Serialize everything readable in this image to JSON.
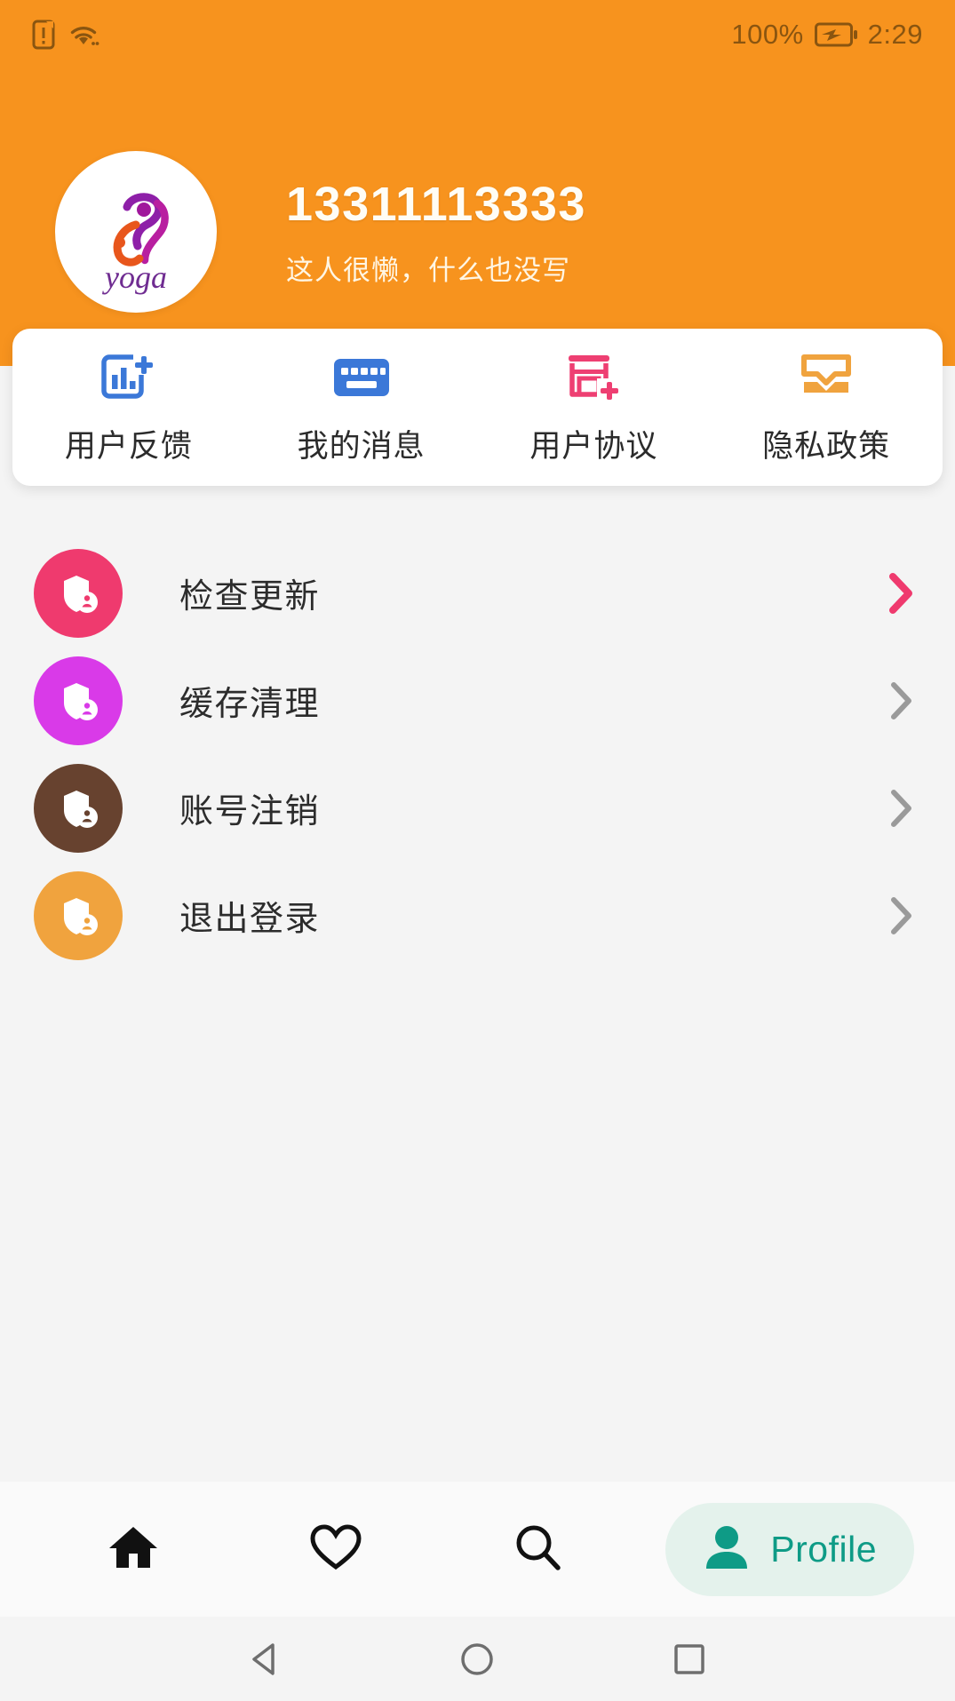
{
  "status_bar": {
    "sim_icon": "sim-alert-icon",
    "wifi_icon": "wifi-icon",
    "battery_percent": "100%",
    "battery_icon": "battery-charging-icon",
    "time": "2:29"
  },
  "header": {
    "background_color": "#f7931e",
    "avatar_icon": "yoga-logo-avatar",
    "avatar_logo_text": "yoga",
    "username": "13311113333",
    "signature": "这人很懒，什么也没写"
  },
  "quick_actions": [
    {
      "label": "用户反馈",
      "icon": "chart-add-icon",
      "color": "#3b78d8"
    },
    {
      "label": "我的消息",
      "icon": "keyboard-icon",
      "color": "#3b78d8"
    },
    {
      "label": "用户协议",
      "icon": "shop-add-icon",
      "color": "#ee3f72"
    },
    {
      "label": "隐私政策",
      "icon": "inbox-tray-icon",
      "color": "#f0a33e"
    }
  ],
  "menu": [
    {
      "label": "检查更新",
      "icon": "shield-user-icon",
      "badge_color": "#ef3a6e",
      "chevron_color": "#ef3a6e"
    },
    {
      "label": "缓存清理",
      "icon": "shield-user-icon",
      "badge_color": "#d93ae8",
      "chevron_color": "#9a9a9a"
    },
    {
      "label": "账号注销",
      "icon": "shield-user-icon",
      "badge_color": "#67422f",
      "chevron_color": "#9a9a9a"
    },
    {
      "label": "退出登录",
      "icon": "shield-user-icon",
      "badge_color": "#f0a33e",
      "chevron_color": "#9a9a9a"
    }
  ],
  "bottom_nav": {
    "items": [
      {
        "label": "",
        "icon": "home-icon",
        "active": false
      },
      {
        "label": "",
        "icon": "heart-icon",
        "active": false
      },
      {
        "label": "",
        "icon": "search-icon",
        "active": false
      },
      {
        "label": "Profile",
        "icon": "person-icon",
        "active": true
      }
    ],
    "active_color": "#0e9b86",
    "active_pill_color": "#e4f2ec"
  },
  "system_nav": {
    "back_icon": "back-triangle-icon",
    "home_icon": "home-circle-icon",
    "recents_icon": "recents-square-icon"
  }
}
